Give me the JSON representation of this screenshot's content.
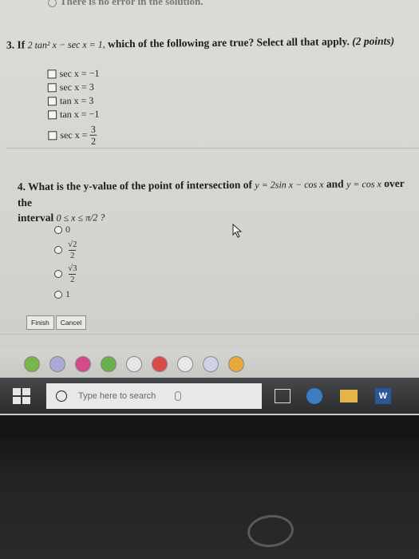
{
  "header_cut": "There is no error in the solution.",
  "question3": {
    "number": "3.",
    "prefix": "If",
    "equation": "2 tan² x − sec x = 1,",
    "text": "which of the following are true? Select all that apply.",
    "points": "(2 points)",
    "options": [
      {
        "label": "sec x = −1",
        "checked": false
      },
      {
        "label": "sec x = 3",
        "checked": false
      },
      {
        "label": "tan x = 3",
        "checked": false
      },
      {
        "label": "tan x = −1",
        "checked": false
      },
      {
        "label_prefix": "sec x =",
        "numerator": "3",
        "denominator": "2",
        "checked": false
      }
    ]
  },
  "question4": {
    "number": "4.",
    "text_a": "What is the y-value of the point of intersection of",
    "eq1": "y = 2sin x − cos x",
    "and": "and",
    "eq2": "y = cos x",
    "text_b": "over the",
    "interval_label": "interval",
    "interval": "0 ≤ x ≤ π/2 ?",
    "choices": [
      {
        "label": "0"
      },
      {
        "numerator": "√2",
        "denominator": "2"
      },
      {
        "numerator": "√3",
        "denominator": "2"
      },
      {
        "label": "1"
      }
    ]
  },
  "buttons": {
    "finish": "Finish",
    "cancel": "Cancel"
  },
  "taskbar": {
    "search_placeholder": "Type here to search",
    "word_label": "W"
  },
  "icons": [
    "check-icon",
    "music-icon",
    "chrome-icon",
    "paint-icon",
    "globe-icon",
    "camera-icon",
    "gear-icon",
    "disc-icon",
    "help-icon"
  ]
}
